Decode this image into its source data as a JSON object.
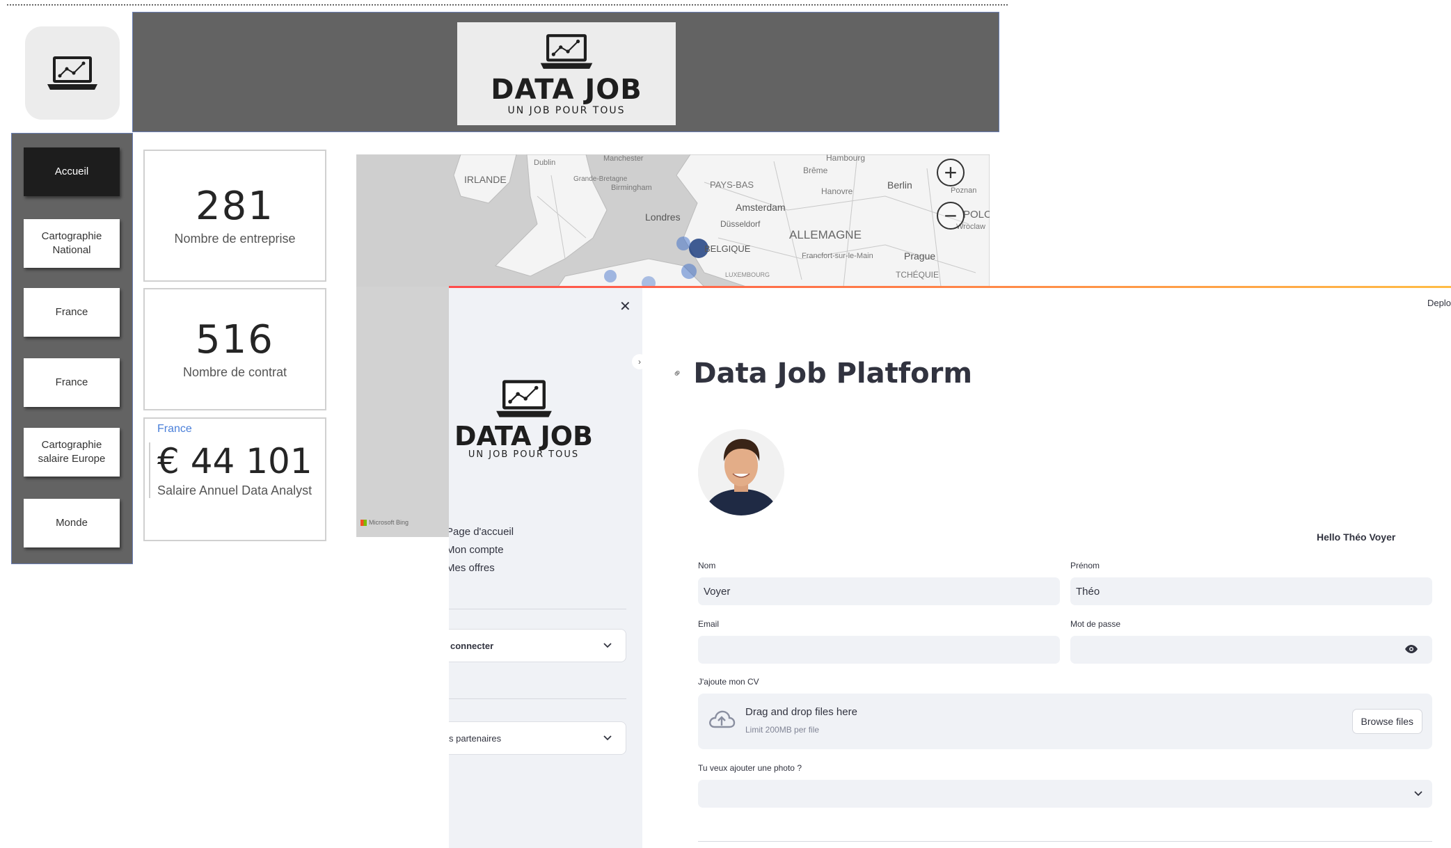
{
  "dashboard": {
    "brand": {
      "name": "DATA JOB",
      "tagline": "UN JOB POUR TOUS"
    },
    "nav": [
      {
        "label": "Accueil",
        "active": true
      },
      {
        "label": "Cartographie National",
        "active": false
      },
      {
        "label": "France",
        "active": false
      },
      {
        "label": "France",
        "active": false
      },
      {
        "label": "Cartographie salaire Europe",
        "active": false
      },
      {
        "label": "Monde",
        "active": false
      }
    ],
    "kpis": {
      "companies": {
        "value": "281",
        "label": "Nombre de entreprise"
      },
      "contracts": {
        "value": "516",
        "label": "Nombre de contrat"
      },
      "salary": {
        "title": "France",
        "value": "€ 44 101",
        "label": "Salaire Annuel Data Analyst"
      }
    },
    "map": {
      "labels": [
        "IRLANDE",
        "Dublin",
        "Manchester",
        "Grande-Bretagne",
        "Birmingham",
        "Londres",
        "PAYS-BAS",
        "Amsterdam",
        "Düsseldorf",
        "BELGIQUE",
        "LUXEMBOURG",
        "ALLEMAGNE",
        "Hambourg",
        "Brême",
        "Hanovre",
        "Berlin",
        "Poznan",
        "POLO",
        "Wroclaw",
        "Prague",
        "TCHÉQUIE",
        "Francfort-sur-le-Main"
      ],
      "zoom_in": "+",
      "zoom_out": "−",
      "credit": "Microsoft Bing"
    }
  },
  "streamlit": {
    "deploy_label": "Deplo",
    "sidebar": {
      "close_glyph": "✕",
      "brand": {
        "name": "DATA JOB",
        "tagline": "UN JOB POUR TOUS"
      },
      "nav": [
        "Page d'accueil",
        "Mon compte",
        "Mes offres"
      ],
      "expander_login": "connecter",
      "expander_partners": "s partenaires"
    },
    "main": {
      "title": "Data Job Platform",
      "hello": "Hello Théo Voyer",
      "fields": {
        "nom": {
          "label": "Nom",
          "value": "Voyer"
        },
        "prenom": {
          "label": "Prénom",
          "value": "Théo"
        },
        "email": {
          "label": "Email",
          "value": ""
        },
        "password": {
          "label": "Mot de passe",
          "value": ""
        }
      },
      "cv": {
        "label": "J'ajoute mon CV",
        "drop_text": "Drag and drop files here",
        "limit": "Limit 200MB per file",
        "browse": "Browse files"
      },
      "photo": {
        "label": "Tu veux ajouter une photo ?",
        "value": ""
      }
    }
  },
  "colors": {
    "accent_red": "#ff4b4b",
    "accent_yellow": "#ffbd45",
    "header_gray": "#636363",
    "nav_active": "#1d1d1d",
    "link_blue": "#4a7fd9"
  }
}
